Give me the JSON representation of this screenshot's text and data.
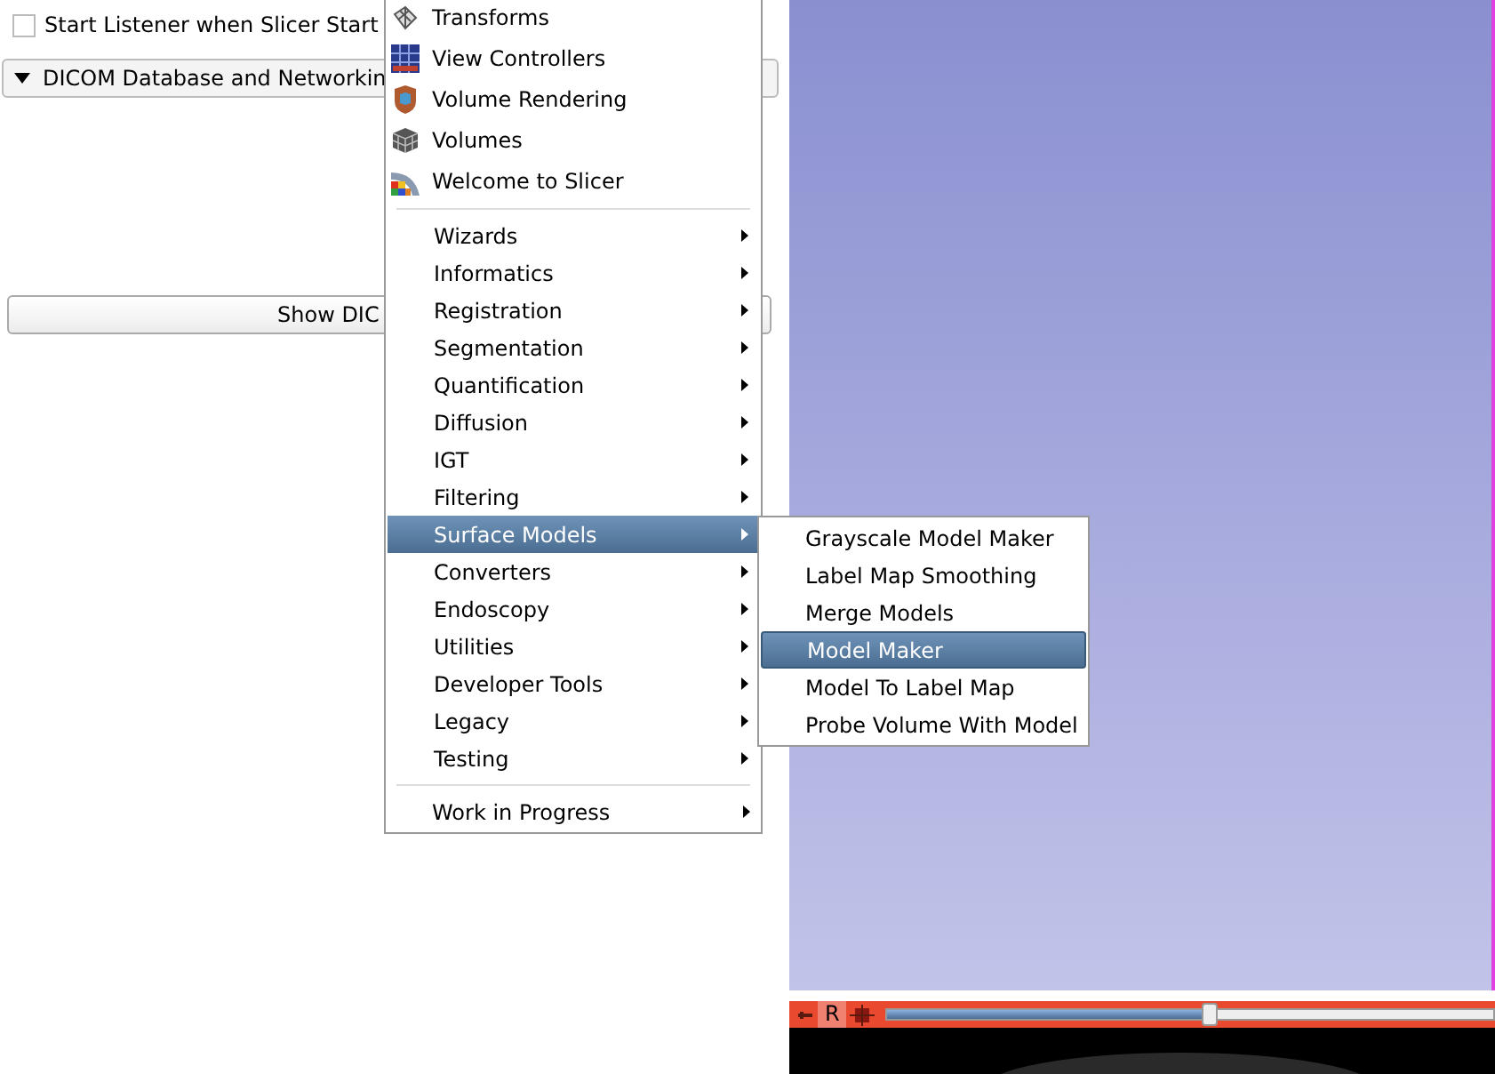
{
  "left_panel": {
    "listener_checkbox": {
      "label": "Start Listener when Slicer Start",
      "checked": false
    },
    "section": {
      "title": "DICOM Database and Networkin",
      "expanded": true
    },
    "show_button": {
      "label": "Show DIC"
    }
  },
  "menu": {
    "icon_items": [
      {
        "label": "Transforms",
        "kind": "transforms"
      },
      {
        "label": "View Controllers",
        "kind": "views"
      },
      {
        "label": "Volume Rendering",
        "kind": "rendering"
      },
      {
        "label": "Volumes",
        "kind": "volumes"
      },
      {
        "label": "Welcome to Slicer",
        "kind": "welcome"
      }
    ],
    "categories": [
      {
        "label": "Wizards",
        "selected": false
      },
      {
        "label": "Informatics",
        "selected": false
      },
      {
        "label": "Registration",
        "selected": false
      },
      {
        "label": "Segmentation",
        "selected": false
      },
      {
        "label": "Quantification",
        "selected": false
      },
      {
        "label": "Diffusion",
        "selected": false
      },
      {
        "label": "IGT",
        "selected": false
      },
      {
        "label": "Filtering",
        "selected": false
      },
      {
        "label": "Surface Models",
        "selected": true
      },
      {
        "label": "Converters",
        "selected": false
      },
      {
        "label": "Endoscopy",
        "selected": false
      },
      {
        "label": "Utilities",
        "selected": false
      },
      {
        "label": "Developer Tools",
        "selected": false
      },
      {
        "label": "Legacy",
        "selected": false
      },
      {
        "label": "Testing",
        "selected": false
      }
    ],
    "bottom_item": {
      "label": "Work in Progress"
    }
  },
  "submenu": {
    "items": [
      {
        "label": "Grayscale Model Maker",
        "selected": false
      },
      {
        "label": "Label Map Smoothing",
        "selected": false
      },
      {
        "label": "Merge Models",
        "selected": false
      },
      {
        "label": "Model Maker",
        "selected": true
      },
      {
        "label": "Model To Label Map",
        "selected": false
      },
      {
        "label": "Probe Volume With Model",
        "selected": false
      }
    ]
  },
  "slice_view": {
    "orientation_label": "R",
    "slider": {
      "level": 0.53
    }
  }
}
